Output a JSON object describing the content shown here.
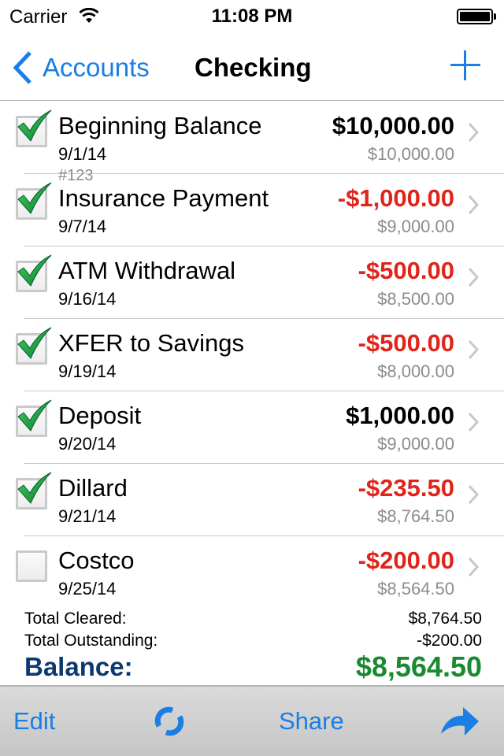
{
  "status_bar": {
    "carrier": "Carrier",
    "time": "11:08 PM",
    "wifi_icon": "wifi-icon",
    "battery_icon": "battery-icon",
    "battery_level_percent": 100
  },
  "nav": {
    "back_label": "Accounts",
    "title": "Checking",
    "add_icon": "plus-icon"
  },
  "colors": {
    "accent": "#1a7ee6",
    "negative": "#e0241b",
    "positive_balance": "#1a8a31",
    "balance_label": "#0d3a6e",
    "secondary_text": "#8c8c8c"
  },
  "transactions": [
    {
      "name": "Beginning Balance",
      "date": "9/1/14",
      "amount": "$10,000.00",
      "negative": false,
      "running_balance": "$10,000.00",
      "cleared": true,
      "check_number": ""
    },
    {
      "name": "Insurance Payment",
      "date": "9/7/14",
      "amount": "-$1,000.00",
      "negative": true,
      "running_balance": "$9,000.00",
      "cleared": true,
      "check_number": "#123"
    },
    {
      "name": "ATM Withdrawal",
      "date": "9/16/14",
      "amount": "-$500.00",
      "negative": true,
      "running_balance": "$8,500.00",
      "cleared": true,
      "check_number": ""
    },
    {
      "name": "XFER to Savings",
      "date": "9/19/14",
      "amount": "-$500.00",
      "negative": true,
      "running_balance": "$8,000.00",
      "cleared": true,
      "check_number": ""
    },
    {
      "name": "Deposit",
      "date": "9/20/14",
      "amount": "$1,000.00",
      "negative": false,
      "running_balance": "$9,000.00",
      "cleared": true,
      "check_number": ""
    },
    {
      "name": "Dillard",
      "date": "9/21/14",
      "amount": "-$235.50",
      "negative": true,
      "running_balance": "$8,764.50",
      "cleared": true,
      "check_number": ""
    },
    {
      "name": "Costco",
      "date": "9/25/14",
      "amount": "-$200.00",
      "negative": true,
      "running_balance": "$8,564.50",
      "cleared": false,
      "check_number": ""
    }
  ],
  "totals": {
    "cleared_label": "Total Cleared:",
    "cleared_value": "$8,764.50",
    "outstanding_label": "Total Outstanding:",
    "outstanding_value": "-$200.00",
    "balance_label": "Balance:",
    "balance_value": "$8,564.50"
  },
  "toolbar": {
    "edit_label": "Edit",
    "refresh_icon": "refresh-icon",
    "share_label": "Share",
    "forward_icon": "forward-arrow-icon"
  }
}
